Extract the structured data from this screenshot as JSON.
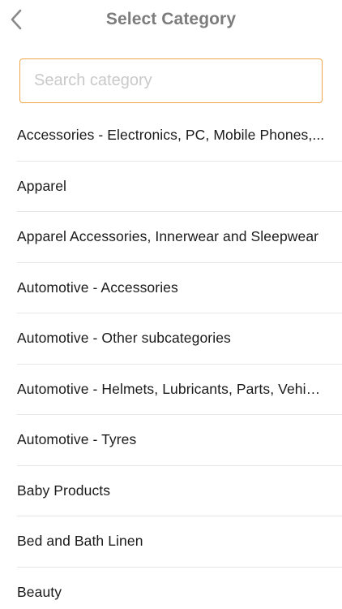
{
  "header": {
    "title": "Select Category",
    "back_icon": "chevron-left-icon"
  },
  "search": {
    "placeholder": "Search category",
    "value": "",
    "border_color": "#f0a54b"
  },
  "categories": [
    {
      "label": "Accessories - Electronics, PC, Mobile Phones,..."
    },
    {
      "label": "Apparel"
    },
    {
      "label": "Apparel Accessories, Innerwear and Sleepwear"
    },
    {
      "label": "Automotive - Accessories"
    },
    {
      "label": "Automotive - Other subcategories"
    },
    {
      "label": "Automotive - Helmets, Lubricants, Parts, Vehicl..."
    },
    {
      "label": "Automotive - Tyres"
    },
    {
      "label": "Baby Products"
    },
    {
      "label": "Bed and Bath Linen"
    },
    {
      "label": "Beauty"
    }
  ]
}
